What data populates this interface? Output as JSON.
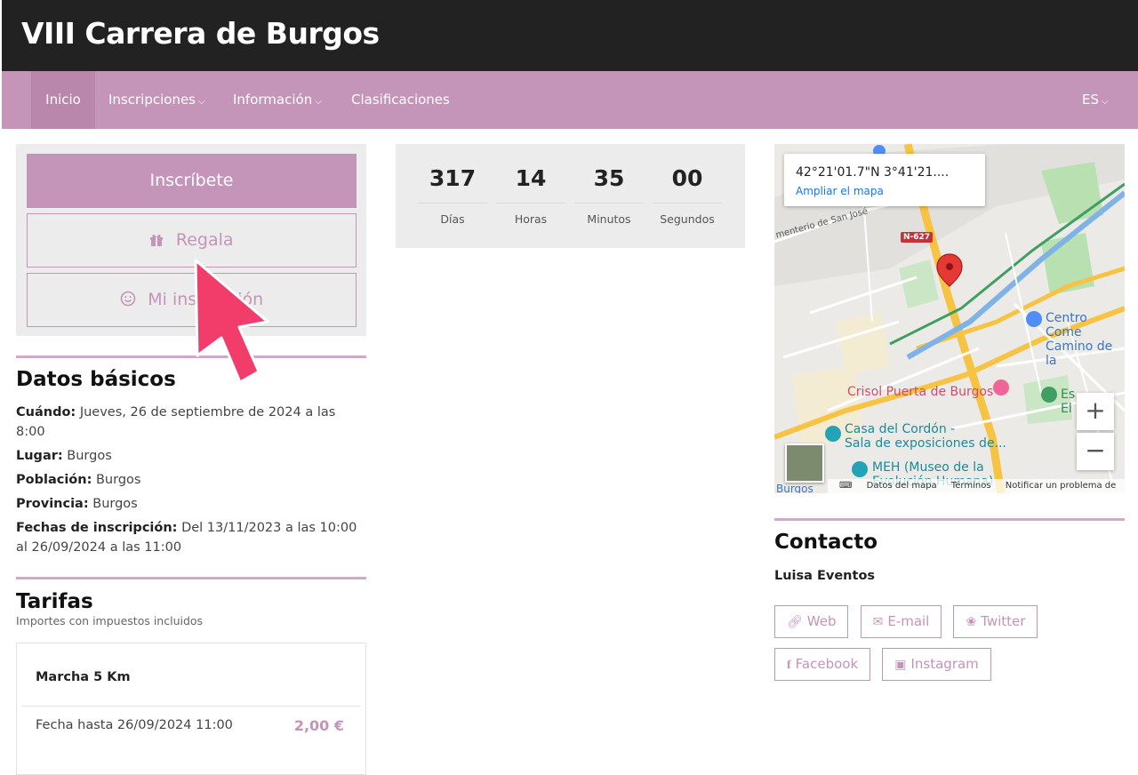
{
  "header": {
    "title": "VIII Carrera de Burgos"
  },
  "nav": {
    "items": [
      {
        "label": "Inicio",
        "active": true
      },
      {
        "label": "Inscripciones",
        "dropdown": true
      },
      {
        "label": "Información",
        "dropdown": true
      },
      {
        "label": "Clasificaciones"
      }
    ],
    "lang": "ES"
  },
  "actions": {
    "register": "Inscríbete",
    "gift": "Regala",
    "my_registration": "Mi inscripción"
  },
  "countdown": [
    {
      "value": "317",
      "label": "Días"
    },
    {
      "value": "14",
      "label": "Horas"
    },
    {
      "value": "35",
      "label": "Minutos"
    },
    {
      "value": "00",
      "label": "Segundos"
    }
  ],
  "basics": {
    "title": "Datos básicos",
    "when_label": "Cuándo:",
    "when": "Jueves, 26 de septiembre de 2024 a las 8:00",
    "place_label": "Lugar:",
    "place": "Burgos",
    "town_label": "Población:",
    "town": "Burgos",
    "province_label": "Provincia:",
    "province": "Burgos",
    "dates_label": "Fechas de inscripción:",
    "dates": "Del 13/11/2023 a las 10:00 al 26/09/2024 a las 11:00"
  },
  "rates": {
    "title": "Tarifas",
    "subtitle": "Importes con impuestos incluidos",
    "items": [
      {
        "name": "Marcha 5 Km",
        "date": "Fecha hasta 26/09/2024 11:00",
        "price": "2,00 €"
      }
    ]
  },
  "map": {
    "coords": "42°21'01.7\"N 3°41'21....",
    "expand_link": "Ampliar el mapa",
    "zoom_in": "+",
    "zoom_out": "−",
    "labels": {
      "road": "N-627",
      "street": "menterio de San José",
      "poi1": "Centro Come",
      "poi1b": "Camino de la",
      "poi2": "Crisol Puerta de Burgos",
      "poi3": "Casa del Cordón -",
      "poi3b": "Sala de exposiciones de...",
      "poi4": "MEH (Museo de la",
      "poi4b": "Evolución Humana)",
      "poi5": "Es",
      "poi5b": "El",
      "town": "Burgos"
    },
    "footer": [
      "Datos del mapa",
      "Términos",
      "Notificar un problema de Maps"
    ],
    "colors": {
      "pin": "#e53935",
      "road": "#f6c342",
      "rail": "#4a8fd6",
      "park": "#a8d8a8"
    }
  },
  "contact": {
    "title": "Contacto",
    "organizer": "Luisa Eventos",
    "links": [
      {
        "label": "Web",
        "icon": "link-icon"
      },
      {
        "label": "E-mail",
        "icon": "envelope-icon"
      },
      {
        "label": "Twitter",
        "icon": "twitter-icon"
      },
      {
        "label": "Facebook",
        "icon": "facebook-icon"
      },
      {
        "label": "Instagram",
        "icon": "instagram-icon"
      }
    ]
  },
  "theme": {
    "accent": "#c494b9",
    "header_bg": "#222222",
    "cursor": "#f23d6b"
  }
}
